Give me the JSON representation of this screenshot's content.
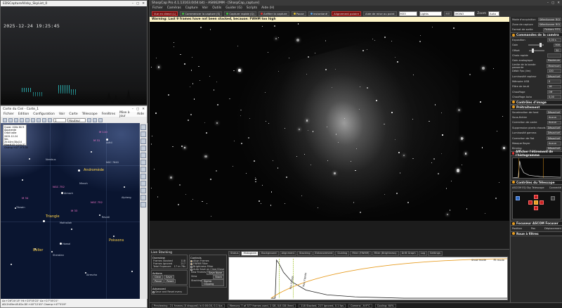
{
  "camwin": {
    "title": "EDSCaptureAllsky_SkyList_0",
    "timestamp": "2025-12-24  19:25:45"
  },
  "sky": {
    "title": "Carte du Ciel - Carte_1",
    "menu": [
      "Fichier",
      "Edition",
      "Configuration",
      "Voir",
      "Carte",
      "Télescope",
      "Fenêtres",
      "Mise à jour",
      "Aide"
    ],
    "fov_value": "1",
    "zoom_value": "Hauteur",
    "info_lines": [
      "Quasi: 400x 80 ft",
      "Apparente",
      "Orbit taille",
      "2025-12-24",
      "Ver-2h:44m:30s/14",
      "Mag:6.05 0.0:0.5°",
      "Champ:+47°-9°3:35"
    ],
    "labels": {
      "andromeda": "Andromède",
      "triangle": "Triangle",
      "belier": "Bélier",
      "poissons": "Poissons",
      "m31": "M 31",
      "m110": "M 110",
      "m33": "M 33",
      "m34": "M 34",
      "ngc752": "NGC 752",
      "ngc752b": "NGC 752",
      "alamak": "Almach",
      "mirach": "Mirach",
      "hamal": "Hamal",
      "sheratan": "Sheratan",
      "mothallah": "Mothallah",
      "adhil": "Adhil",
      "nembus": "Nembus",
      "titawin": "Titawin",
      "revati": "Revati",
      "alrescha": "Alrescha",
      "alpherg": "Alpherg",
      "ngc7640": "NGC 7640"
    },
    "status_line1": "Az:+26°20'13\"  Ht:+25°05'22\"  Az:+27°05'21\"",
    "status_line2": "AD:2h05m45.82s  DE:+40°12'45\"  Champ:+47°5'09\"",
    "status_line3": "AD:2h02m47.90s  DE:+40°14'2\""
  },
  "cap": {
    "title": "SharpCap Pro 4.1.13163.0(64 bit)  -  ASI662MM  -  [SharpCap_capture]",
    "menu": [
      "Fichier",
      "Caméras",
      "Capture",
      "Voir",
      "Outils",
      "Guider (G)",
      "Scripts",
      "Aide (H)"
    ],
    "toolbar": {
      "live": "Vue en direct (L)",
      "start": "Commencer la capture (S)",
      "quick": "Capture rapide (Q)",
      "stop": "Arrêter la capture",
      "pause": "Pause",
      "snapshot": "Instantané",
      "polar": "Alignement polaire",
      "focus": "Aide de mise au point",
      "zoom_label": "Zoom",
      "zoom_value": "Auto",
      "fit": "FIT",
      "mono": "MONO",
      "lights": "Lights",
      "filename": "M33"
    },
    "warning": "Warning: Last 9 frames have not been stacked, because: FWHM too high"
  },
  "panel": {
    "s1_rows": [
      {
        "label": "Mode d'acquisition",
        "value": "Sélectionner ROI"
      },
      {
        "label": "Zone de capture",
        "value": "Sélectionner ROI"
      },
      {
        "label": "Format de sortie",
        "value": "Fichiers FITS"
      }
    ],
    "s2_title": "Commandes de la caméra",
    "s2_rows": [
      {
        "label": "Exposition",
        "value": "5,00 s"
      },
      {
        "label": "Gain",
        "value": "300"
      },
      {
        "label": "Offset",
        "value": "30"
      },
      {
        "label": "Choix rapide",
        "value": ""
      },
      {
        "label": "Gain analogique",
        "value": "Maximum"
      },
      {
        "label": "Limite de la bande passante",
        "value": "Maximum"
      },
      {
        "label": "Débit Fps (lim)",
        "value": "120"
      },
      {
        "label": "Luminosité capteur",
        "value": "Désactivé"
      },
      {
        "label": "Mémoire USB",
        "value": "0"
      },
      {
        "label": "Filtre de bruit",
        "value": "16"
      },
      {
        "label": "Chauffage",
        "value": "Off"
      },
      {
        "label": "Chauffage Auto",
        "value": "0,00"
      }
    ],
    "s3_title": "Contrôles d'image",
    "s4_title": "Prétraitement",
    "s4_rows": [
      {
        "label": "Soustraction de fond",
        "value": "Désactivé"
      },
      {
        "label": "Sous-fichier",
        "value": "Aucun"
      },
      {
        "label": "Correction de cadre",
        "value": "Aucun"
      },
      {
        "label": "Suppression pixels chauds",
        "value": "Désactivé"
      },
      {
        "label": "Luminosité gamma",
        "value": "Désactivé"
      },
      {
        "label": "Correction de flat",
        "value": "Désactivé"
      },
      {
        "label": "Masque Bayer",
        "value": "Aucun"
      },
      {
        "label": "Binning",
        "value": "Désactivé"
      }
    ],
    "histo_title": "Afficher l'étirement de l'histogramme",
    "scope_title": "Contrôles du Télescope",
    "scope_name": "ASCOM EQ Sky Telescope",
    "scope_status": "Connecté",
    "focuser_title": "Focuseur ASCOM Focuser",
    "focuser_values": [
      "Position",
      "Pas",
      "Déplacement"
    ],
    "filter_title": "Roue à filtres"
  },
  "stack": {
    "title": "Live Stacking",
    "overview": "Overview",
    "frames_stacked_label": "Frames Stacked",
    "frames_stacked": "118",
    "frames_ignored_label": "Frames Ignored",
    "frames_ignored": "217",
    "total_exp_label": "Total Exposure",
    "total_exp": "17 m 76s",
    "actions": "Actions",
    "clear": "Clear",
    "save": "Save",
    "pause": "Pause",
    "reset": "Reset",
    "controls": "Controls",
    "ctrl1": "Align Frames",
    "ctrl2": "FWHM Filter",
    "ctrl3": "Brightness Filter",
    "ctrl4": "Auto Save on Clear/Close",
    "raw_frames": "Raw Frames",
    "raw_value": "Save None",
    "view_label": "View",
    "view_value": "Stack",
    "stacking_label": "Stacking",
    "stacking_value": "Sigma Clipping",
    "advanced": "Advanced",
    "advanced_opt": "Save and Reset every",
    "tabs": [
      "Status",
      "Histogram",
      "Background",
      "Alignment",
      "Stacking",
      "Enhancement",
      "Guiding",
      "Filter (FWHM)",
      "Filter (Brightness)",
      "Drift Graph",
      "Log",
      "Settings"
    ],
    "graph_lbl1": "Min FWHM",
    "graph_lbl2": "Max FWHM",
    "graph_right": "Show mode",
    "graph_right2": "Fit mode"
  },
  "status": {
    "s1": "Previewing : 21 frames (0 dropped) in 0:00:00, 0.1 fps",
    "s2": "Memory: 7 of 377 frames used, 1 GB, 0/4 GB (free)",
    "s3": "118 Stacked, 217 Ignored, 0.1 fps",
    "s4": "Camera: -9.9°C",
    "s5": "Cooling: 64%"
  }
}
